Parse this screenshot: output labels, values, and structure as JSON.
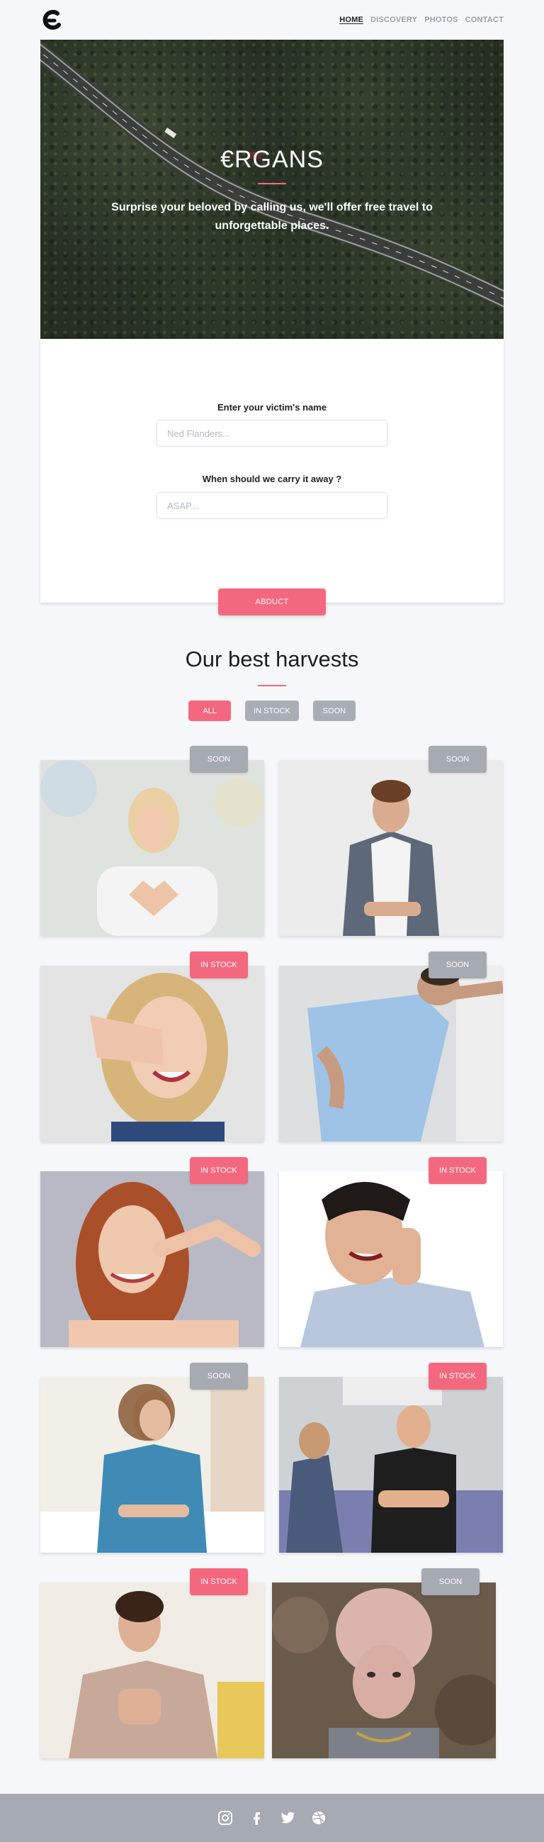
{
  "nav": {
    "links": [
      "HOME",
      "DISCOVERY",
      "PHOTOS",
      "CONTACT"
    ]
  },
  "hero": {
    "title": "€RGANS",
    "subtitle": "Surprise your beloved by calling us, we'll offer free travel to unforgettable places."
  },
  "form": {
    "name_label": "Enter your victim's name",
    "name_placeholder": "Ned Flanders...",
    "when_label": "When should we carry it away ?",
    "when_placeholder": "ASAP...",
    "submit_label": "ABDUCT"
  },
  "section": {
    "title": "Our best harvests",
    "filters": [
      "ALL",
      "IN STOCK",
      "SOON"
    ],
    "active_filter": "ALL"
  },
  "items": [
    {
      "status": "SOON"
    },
    {
      "status": "SOON"
    },
    {
      "status": "IN STOCK"
    },
    {
      "status": "SOON"
    },
    {
      "status": "IN STOCK"
    },
    {
      "status": "IN STOCK"
    },
    {
      "status": "SOON"
    },
    {
      "status": "IN STOCK"
    },
    {
      "status": "IN STOCK"
    },
    {
      "status": "SOON"
    }
  ],
  "footer": {
    "icons": [
      "instagram-icon",
      "facebook-icon",
      "twitter-icon",
      "dribbble-icon"
    ]
  },
  "colors": {
    "accent": "#f4687f",
    "muted": "#a6aab1",
    "footer": "#a6abb3"
  }
}
